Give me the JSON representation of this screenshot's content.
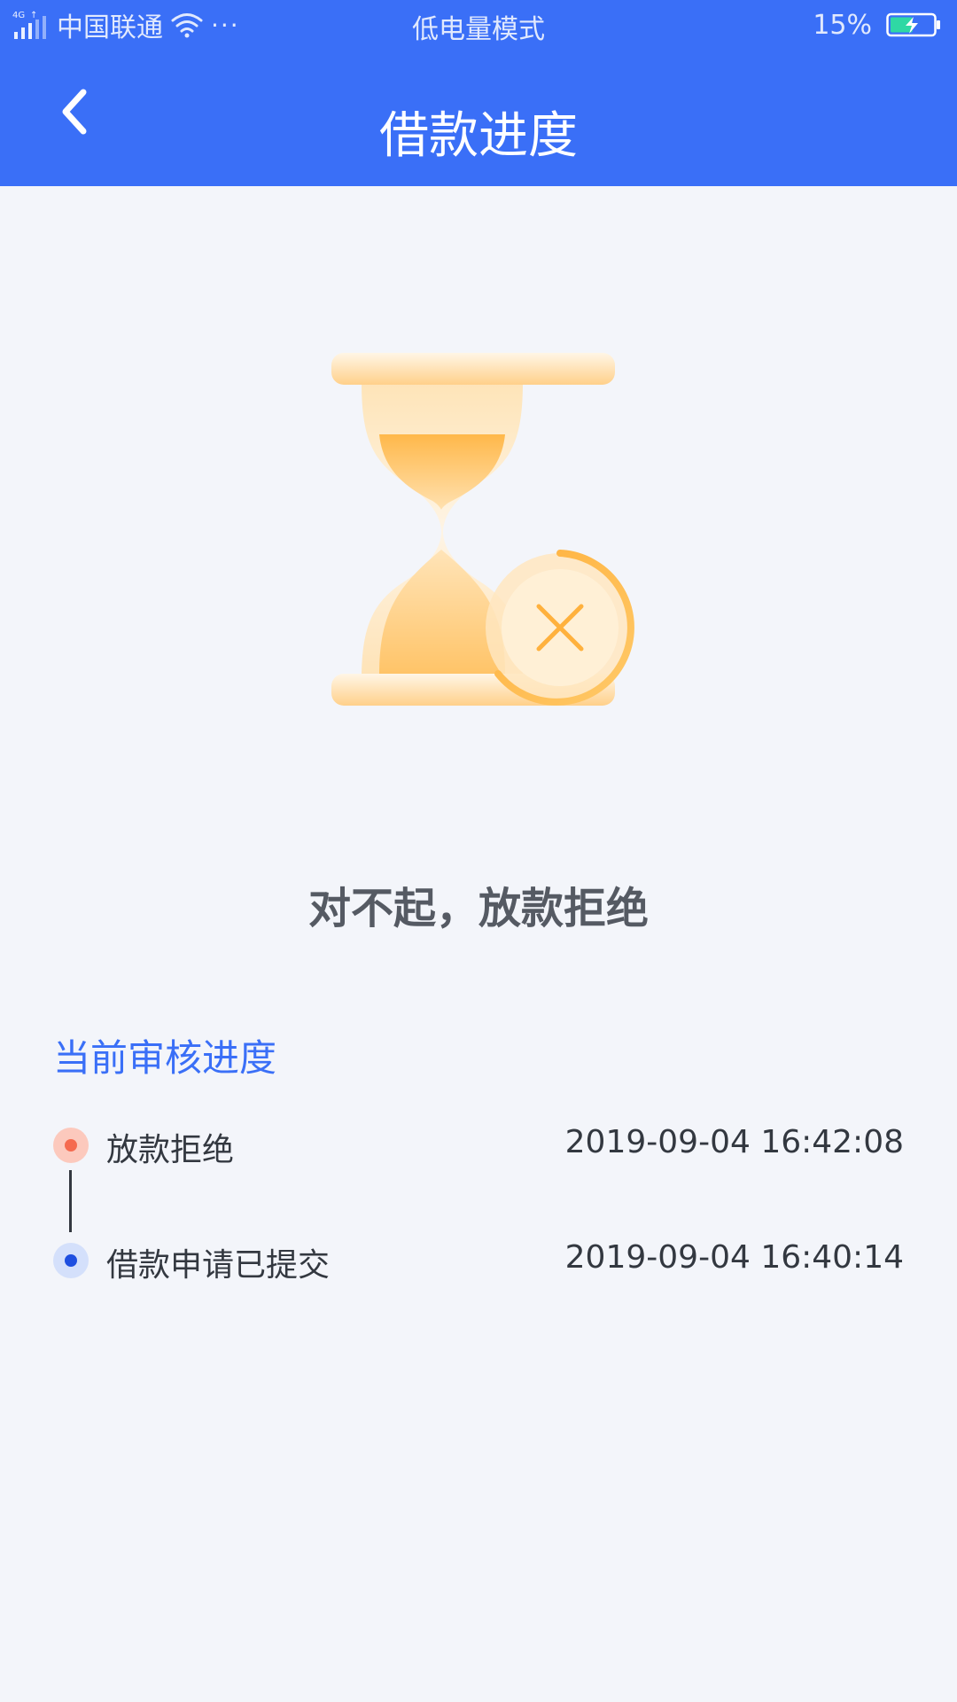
{
  "status_bar": {
    "network": "4G",
    "carrier": "中国联通",
    "more": "···",
    "mode": "低电量模式",
    "battery_percent": "15%",
    "battery_level": 0.15
  },
  "nav": {
    "title": "借款进度"
  },
  "result": {
    "message": "对不起，放款拒绝"
  },
  "progress": {
    "section_title": "当前审核进度",
    "steps": [
      {
        "label": "放款拒绝",
        "time": "2019-09-04 16:42:08",
        "status": "rejected"
      },
      {
        "label": "借款申请已提交",
        "time": "2019-09-04 16:40:14",
        "status": "submitted"
      }
    ]
  },
  "colors": {
    "primary": "#3a6ff7",
    "background": "#f3f5fa",
    "reject_dot": "#f56a4f",
    "reject_halo": "#fcc9bd",
    "submit_dot": "#1e4fe0",
    "submit_halo": "#d4e0fb",
    "hourglass_gold": "#ffbe4f"
  },
  "icons": {
    "back": "chevron-left-icon",
    "illustration": "hourglass-reject-icon"
  }
}
